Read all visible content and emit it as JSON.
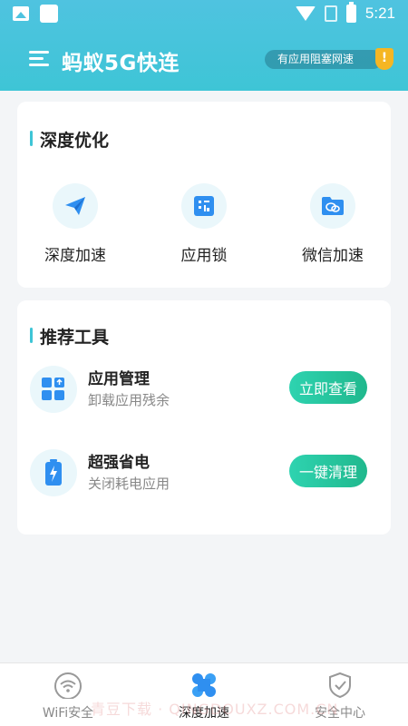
{
  "status_bar": {
    "time": "5:21"
  },
  "header": {
    "app_title": "蚂蚁5G快连",
    "blocked_notice": "有应用阻塞网速",
    "warning_mark": "!"
  },
  "deep_optimize": {
    "title": "深度优化",
    "items": [
      {
        "label": "深度加速",
        "icon": "paper-plane-icon"
      },
      {
        "label": "应用锁",
        "icon": "app-lock-icon"
      },
      {
        "label": "微信加速",
        "icon": "wechat-folder-icon"
      }
    ]
  },
  "tools": {
    "title": "推荐工具",
    "items": [
      {
        "name": "应用管理",
        "subtitle": "卸载应用残余",
        "button": "立即查看",
        "icon": "app-manage-icon"
      },
      {
        "name": "超强省电",
        "subtitle": "关闭耗电应用",
        "button": "一键清理",
        "icon": "battery-saver-icon"
      }
    ]
  },
  "bottom_nav": {
    "items": [
      {
        "label": "WiFi安全",
        "icon": "wifi-icon",
        "active": false
      },
      {
        "label": "深度加速",
        "icon": "clover-icon",
        "active": true
      },
      {
        "label": "安全中心",
        "icon": "shield-check-icon",
        "active": false
      }
    ]
  },
  "watermark": "青豆下载 · QINGDOUXZ.COM.CN",
  "colors": {
    "header": "#3ec5d6",
    "accent_button": "#20b88d",
    "warning": "#f5b623",
    "icon_blue": "#2f8ff0"
  }
}
